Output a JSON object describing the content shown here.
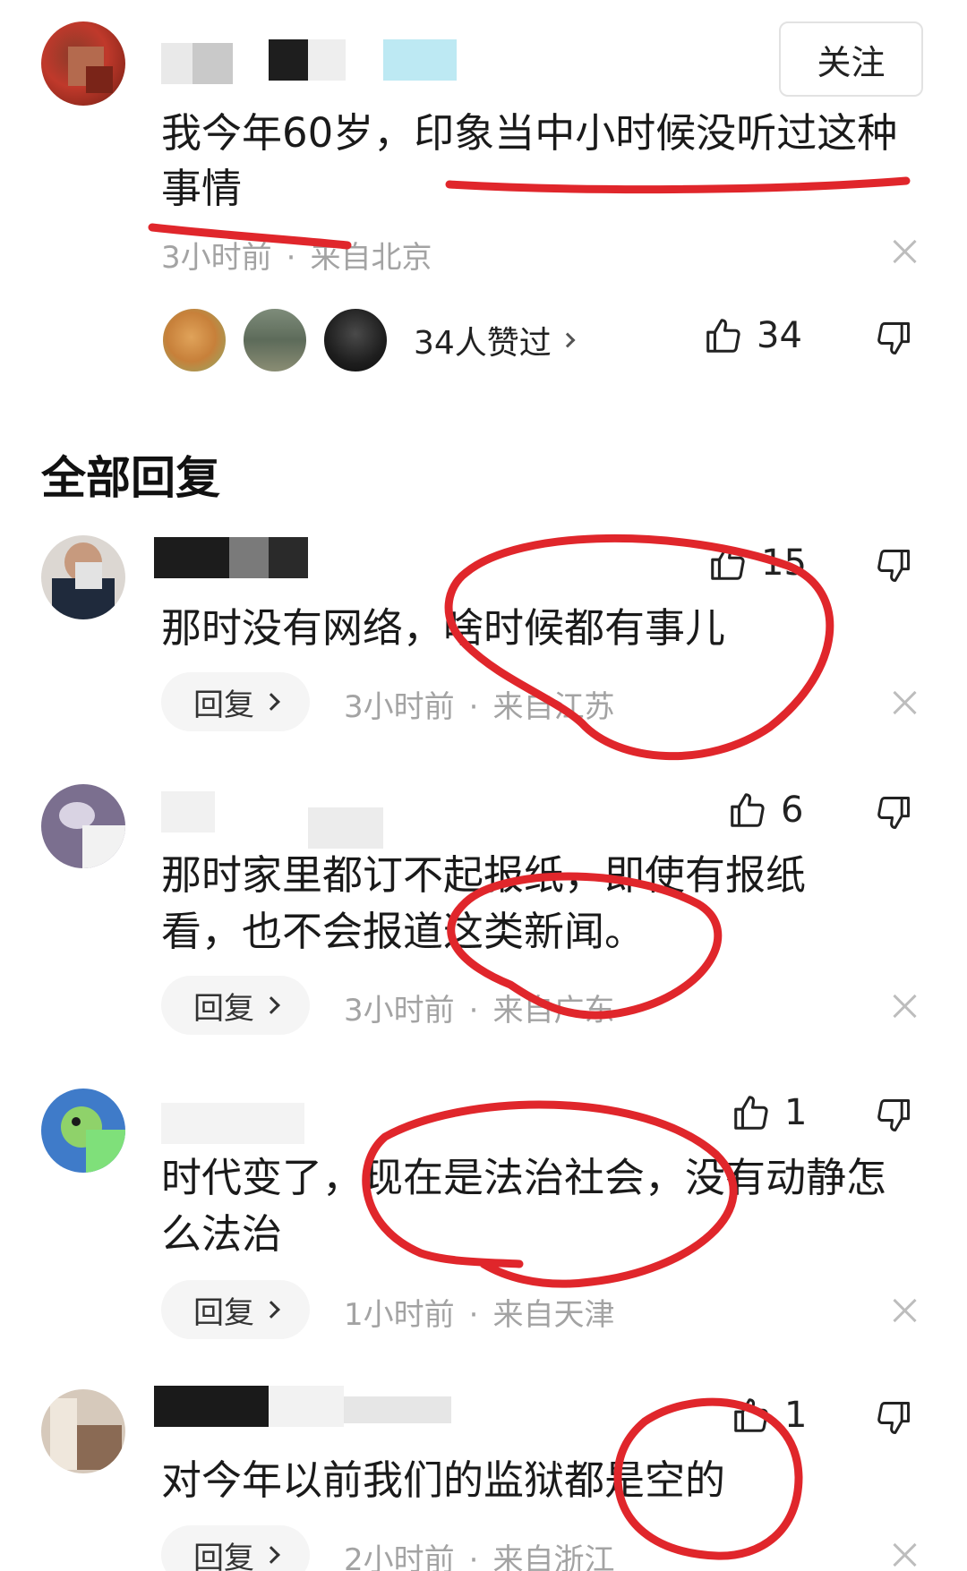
{
  "main_comment": {
    "follow_label": "关注",
    "text": "我今年60岁，印象当中小时候没听过这种事情",
    "time": "3小时前",
    "location": "来自北京",
    "liked_summary": "34人赞过",
    "like_count": "34"
  },
  "section_title": "全部回复",
  "reply_label": "回复",
  "replies": [
    {
      "text": "那时没有网络，啥时候都有事儿",
      "time": "3小时前",
      "location": "来自江苏",
      "like_count": "15"
    },
    {
      "text": "那时家里都订不起报纸，即使有报纸看，也不会报道这类新闻。",
      "time": "3小时前",
      "location": "来自广东",
      "like_count": "6"
    },
    {
      "text": "时代变了，现在是法治社会，没有动静怎么法治",
      "time": "1小时前",
      "location": "来自天津",
      "like_count": "1"
    },
    {
      "text": "对今年以前我们的监狱都是空的",
      "time": "2小时前",
      "location": "来自浙江",
      "like_count": "1"
    }
  ],
  "colors": {
    "annotation_red": "#e0262b",
    "meta_gray": "#a3a3a3"
  },
  "icons": [
    "thumbs-up-icon",
    "thumbs-down-icon",
    "close-icon",
    "chevron-right-icon"
  ]
}
